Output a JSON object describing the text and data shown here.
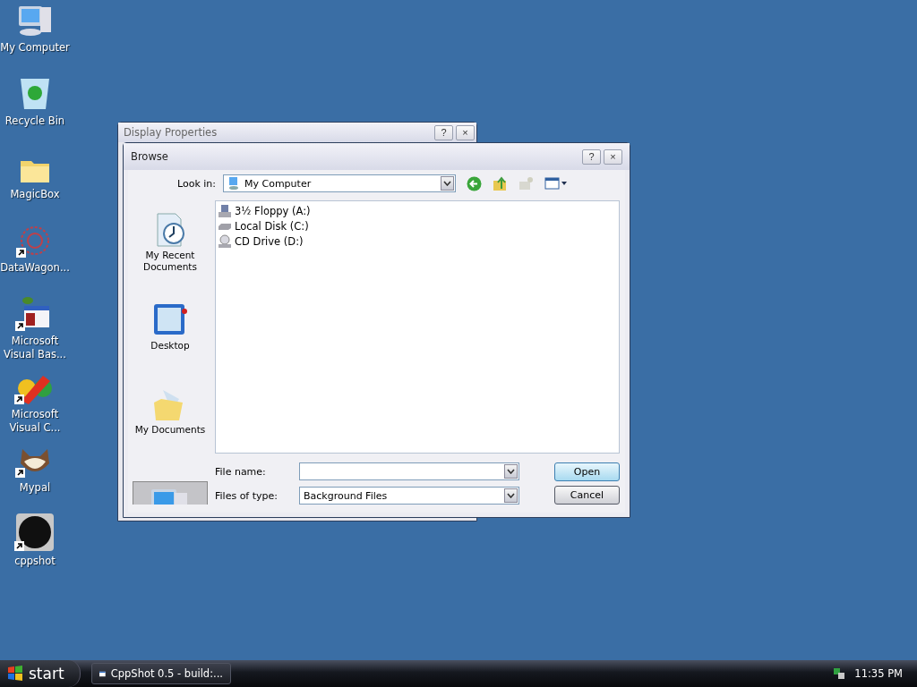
{
  "desktop_icons": [
    {
      "label": "My Computer",
      "kind": "computer",
      "shortcut": false
    },
    {
      "label": "Recycle Bin",
      "kind": "recycle",
      "shortcut": false
    },
    {
      "label": "MagicBox",
      "kind": "folder",
      "shortcut": false
    },
    {
      "label": "DataWagon...",
      "kind": "wagon",
      "shortcut": true
    },
    {
      "label": "Microsoft Visual Bas...",
      "kind": "vb",
      "shortcut": true
    },
    {
      "label": "Microsoft Visual C...",
      "kind": "vc",
      "shortcut": true
    },
    {
      "label": "Mypal",
      "kind": "raccoon",
      "shortcut": true
    },
    {
      "label": "cppshot",
      "kind": "cppshot",
      "shortcut": true
    }
  ],
  "back_window": {
    "title": "Display Properties",
    "help": "?",
    "close": "×"
  },
  "dialog": {
    "title": "Browse",
    "help": "?",
    "close": "×",
    "look_in": {
      "label": "Look in:",
      "value": "My Computer"
    },
    "places": [
      {
        "label": "My Recent Documents",
        "kind": "recent",
        "selected": false
      },
      {
        "label": "Desktop",
        "kind": "desktop",
        "selected": false
      },
      {
        "label": "My Documents",
        "kind": "documents",
        "selected": false
      },
      {
        "kind": "computer",
        "selected": true
      }
    ],
    "files": [
      {
        "name": "3½ Floppy (A:)",
        "kind": "floppy"
      },
      {
        "name": "Local Disk (C:)",
        "kind": "disk"
      },
      {
        "name": "CD Drive (D:)",
        "kind": "cd"
      }
    ],
    "file_name": {
      "label": "File name:"
    },
    "file_type": {
      "label": "Files of type:",
      "value": "Background Files"
    },
    "buttons": [
      {
        "label": "Open",
        "default": true
      },
      {
        "label": "Cancel",
        "default": false
      }
    ]
  },
  "taskbar": {
    "start": "start",
    "tasks": [
      {
        "label": "CppShot 0.5 - build:..."
      }
    ],
    "clock": "11:35 PM"
  }
}
